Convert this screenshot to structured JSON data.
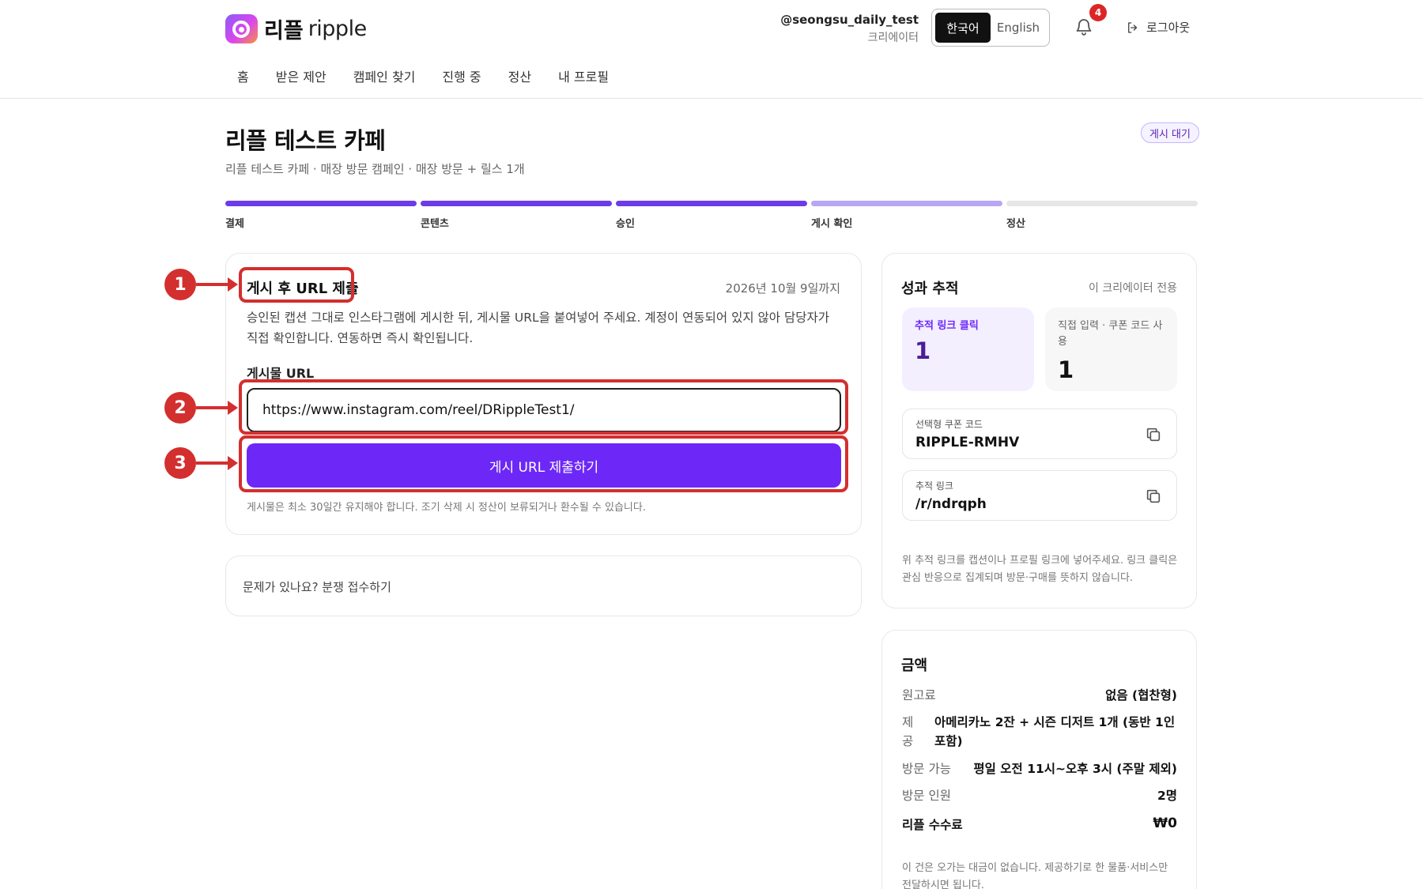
{
  "header": {
    "logo_ko": "리플",
    "logo_en": "ripple",
    "user_handle": "@seongsu_daily_test",
    "user_role": "크리에이터",
    "lang_ko": "한국어",
    "lang_en": "English",
    "active_lang": "한국어",
    "notification_count": "4",
    "logout_label": "로그아웃"
  },
  "nav": {
    "items": [
      "홈",
      "받은 제안",
      "캠페인 찾기",
      "진행 중",
      "정산",
      "내 프로필"
    ]
  },
  "page": {
    "title": "리플 테스트 카페",
    "subtitle": "리플 테스트 카페 · 매장 방문 캠페인 · 매장 방문 + 릴스 1개",
    "status_badge": "게시 대기"
  },
  "progress": {
    "steps": [
      {
        "label": "결제",
        "state": "done"
      },
      {
        "label": "콘텐츠",
        "state": "done"
      },
      {
        "label": "승인",
        "state": "done"
      },
      {
        "label": "게시 확인",
        "state": "current"
      },
      {
        "label": "정산",
        "state": "pending"
      }
    ]
  },
  "submit": {
    "title": "게시 후 URL 제출",
    "deadline": "2026년 10월 9일까지",
    "description": "승인된 캡션 그대로 인스타그램에 게시한 뒤, 게시물 URL을 붙여넣어 주세요. 계정이 연동되어 있지 않아 담당자가 직접 확인합니다. 연동하면 즉시 확인됩니다.",
    "field_label": "게시물 URL",
    "url_value": "https://www.instagram.com/reel/DRippleTest1/",
    "button_label": "게시 URL 제출하기",
    "note": "게시물은 최소 30일간 유지해야 합니다. 조기 삭제 시 정산이 보류되거나 환수될 수 있습니다."
  },
  "dispute": {
    "label": "문제가 있나요? 분쟁 접수하기"
  },
  "tracking": {
    "title": "성과 추적",
    "scope": "이 크리에이터 전용",
    "link_clicks_label": "추적 링크 클릭",
    "link_clicks_value": "1",
    "direct_label": "직접 입력 · 쿠폰 코드 사용",
    "direct_value": "1",
    "coupon_label": "선택형 쿠폰 코드",
    "coupon_value": "RIPPLE-RMHV",
    "link_label": "추적 링크",
    "link_value": "/r/ndrqph",
    "footnote": "위 추적 링크를 캡션이나 프로필 링크에 넣어주세요. 링크 클릭은 관심 반응으로 집계되며 방문·구매를 뜻하지 않습니다."
  },
  "amount": {
    "title": "금액",
    "fee_label": "원고료",
    "fee_value": "없음 (협찬형)",
    "offer_label": "제공",
    "offer_value": "아메리카노 2잔 + 시즌 디저트 1개 (동반 1인 포함)",
    "visit_label": "방문 가능",
    "visit_value": "평일 오전 11시~오후 3시 (주말 제외)",
    "people_label": "방문 인원",
    "people_value": "2명",
    "commission_label": "리플 수수료",
    "commission_value": "₩0",
    "footnote": "이 건은 오가는 대금이 없습니다. 제공하기로 한 물품·서비스만 전달하시면 됩니다."
  },
  "annotations": [
    "1",
    "2",
    "3"
  ],
  "colors": {
    "accent": "#6d28f7",
    "progress_done": "#6d3be8",
    "progress_current": "#b8a6f5",
    "progress_pending": "#e6e6e6",
    "annotation": "#d32f2f"
  }
}
